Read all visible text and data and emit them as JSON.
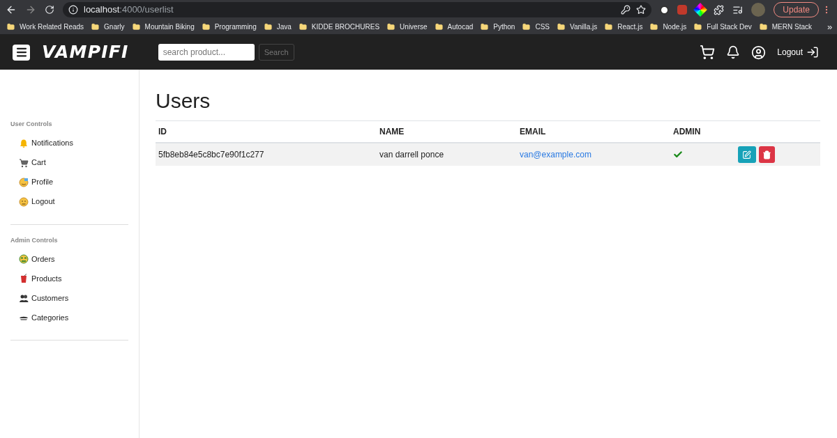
{
  "browser": {
    "url_host": "localhost",
    "url_path": ":4000/userlist",
    "update_button": "Update",
    "more_bookmarks": "»"
  },
  "bookmarks": [
    "Work Related Reads",
    "Gnarly",
    "Mountain Biking",
    "Programming",
    "Java",
    "KIDDE BROCHURES",
    "Universe",
    "Autocad",
    "Python",
    "CSS",
    "Vanilla.js",
    "React.js",
    "Node.js",
    "Full Stack Dev",
    "MERN Stack"
  ],
  "navbar": {
    "brand": "VAMPIFI",
    "search": {
      "placeholder": "search product..."
    },
    "search_button": "Search",
    "logout": "Logout"
  },
  "sidebar": {
    "sections": [
      {
        "title": "User Controls",
        "items": [
          {
            "label": "Notifications",
            "kind": "bell"
          },
          {
            "label": "Cart",
            "kind": "cart"
          },
          {
            "label": "Profile",
            "kind": "face"
          },
          {
            "label": "Logout",
            "kind": "frown"
          }
        ]
      },
      {
        "title": "Admin Controls",
        "items": [
          {
            "label": "Orders",
            "kind": "money"
          },
          {
            "label": "Products",
            "kind": "cup"
          },
          {
            "label": "Customers",
            "kind": "people"
          },
          {
            "label": "Categories",
            "kind": "dish"
          }
        ]
      }
    ]
  },
  "page": {
    "title": "Users"
  },
  "table": {
    "columns": [
      "ID",
      "NAME",
      "EMAIL",
      "ADMIN"
    ],
    "rows": [
      {
        "id": "5fb8eb84e5c8bc7e90f1c277",
        "name": "van darrell ponce",
        "email": "van@example.com",
        "admin": true
      }
    ]
  }
}
